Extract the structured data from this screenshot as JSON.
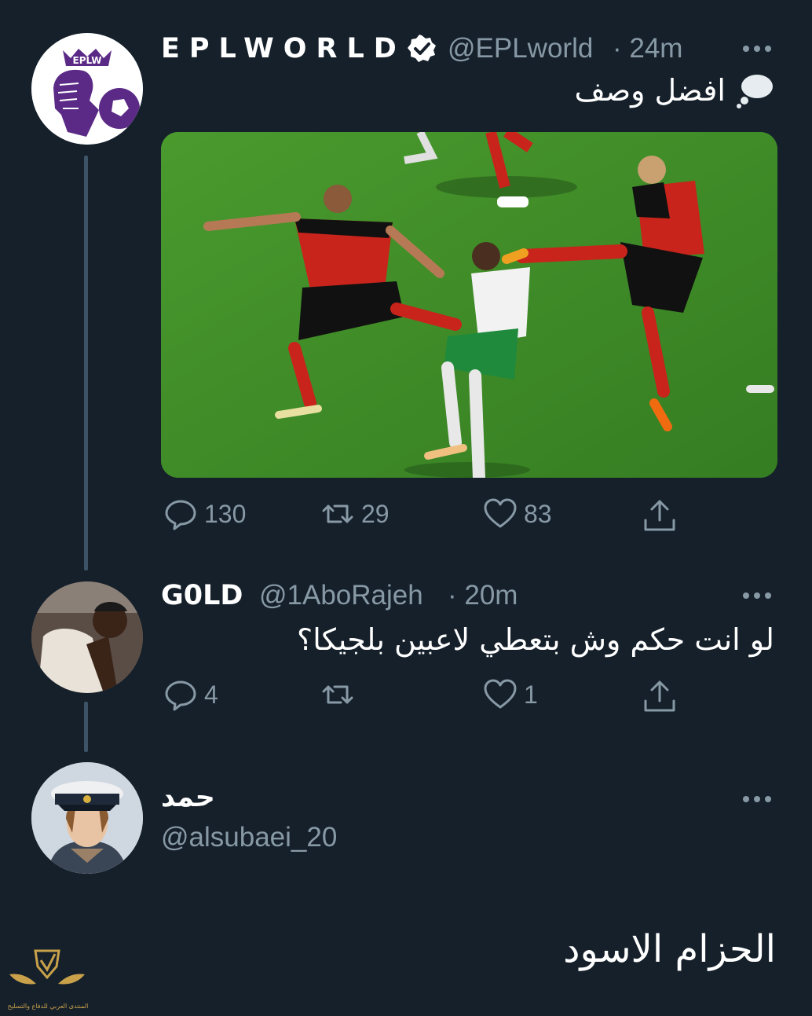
{
  "colors": {
    "background": "#15202b",
    "text": "#ffffff",
    "muted": "#8899a6",
    "pitch": "#3f8a2a",
    "belgium_red": "#c8241b",
    "ireland_green": "#1f8a3c"
  },
  "tweets": [
    {
      "display_name": "EPLWORLD",
      "verified": true,
      "handle": "@EPLworld",
      "time": "· 24m",
      "avatar_icon": "premier-league-lion-icon",
      "text": "افضل وصف",
      "emoji_icon": "thought-bubble-icon",
      "actions": {
        "replies": "130",
        "retweets": "29",
        "likes": "83"
      }
    },
    {
      "display_name": "G0LD",
      "handle": "@1AboRajeh",
      "time": "· 20m",
      "avatar_icon": "player-avatar",
      "text": "لو انت حكم وش بتعطي لاعبين بلجيكا؟",
      "actions": {
        "replies": "4",
        "retweets": "",
        "likes": "1"
      }
    },
    {
      "display_name": "حمد",
      "handle": "@alsubaei_20",
      "avatar_icon": "officer-avatar",
      "text": "الحزام الاسود"
    }
  ],
  "watermark": {
    "text": "المنتدى العربي للدفاع والتسليح",
    "icon": "shield-wings-logo"
  }
}
